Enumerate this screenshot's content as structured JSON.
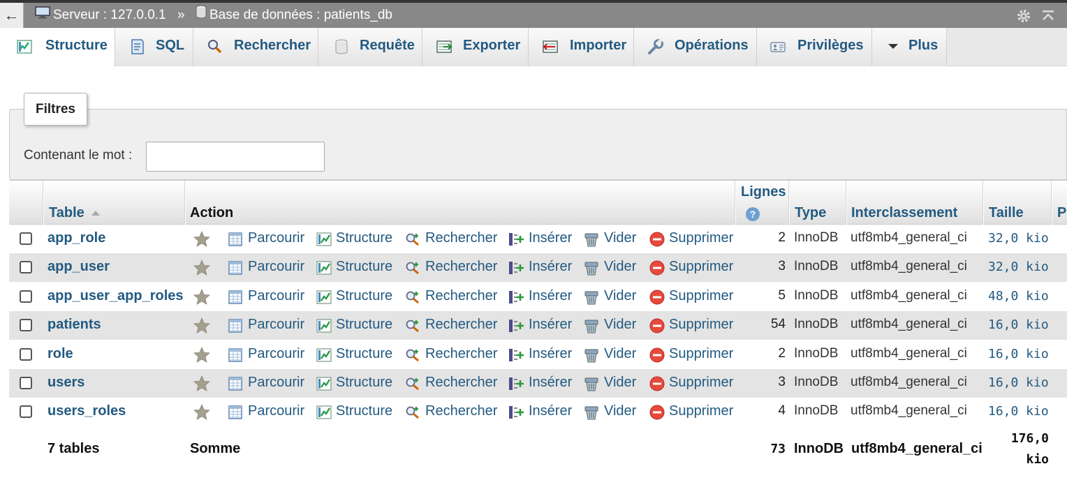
{
  "breadcrumb": {
    "back_symbol": "←",
    "server": "Serveur : 127.0.0.1",
    "separator": "»",
    "database": "Base de données : patients_db"
  },
  "tabs": [
    {
      "label": "Structure",
      "icon": "structure-icon",
      "active": true
    },
    {
      "label": "SQL",
      "icon": "sql-icon"
    },
    {
      "label": "Rechercher",
      "icon": "search-icon"
    },
    {
      "label": "Requête",
      "icon": "query-icon"
    },
    {
      "label": "Exporter",
      "icon": "export-icon"
    },
    {
      "label": "Importer",
      "icon": "import-icon"
    },
    {
      "label": "Opérations",
      "icon": "wrench-icon"
    },
    {
      "label": "Privilèges",
      "icon": "privileges-icon"
    },
    {
      "label": "Plus",
      "icon": "chevron-down-icon"
    }
  ],
  "filters": {
    "legend": "Filtres",
    "label": "Contenant le mot :",
    "value": ""
  },
  "table_headers": {
    "table": "Table",
    "action": "Action",
    "rows": "Lignes",
    "help_symbol": "?",
    "type": "Type",
    "collation": "Interclassement",
    "size": "Taille",
    "overhead": "Pe"
  },
  "actions": {
    "browse": "Parcourir",
    "structure": "Structure",
    "search": "Rechercher",
    "insert": "Insérer",
    "empty": "Vider",
    "drop": "Supprimer"
  },
  "rows": [
    {
      "name": "app_role",
      "rows": "2",
      "type": "InnoDB",
      "collation": "utf8mb4_general_ci",
      "size": "32,0 kio"
    },
    {
      "name": "app_user",
      "rows": "3",
      "type": "InnoDB",
      "collation": "utf8mb4_general_ci",
      "size": "32,0 kio"
    },
    {
      "name": "app_user_app_roles",
      "rows": "5",
      "type": "InnoDB",
      "collation": "utf8mb4_general_ci",
      "size": "48,0 kio"
    },
    {
      "name": "patients",
      "rows": "54",
      "type": "InnoDB",
      "collation": "utf8mb4_general_ci",
      "size": "16,0 kio"
    },
    {
      "name": "role",
      "rows": "2",
      "type": "InnoDB",
      "collation": "utf8mb4_general_ci",
      "size": "16,0 kio"
    },
    {
      "name": "users",
      "rows": "3",
      "type": "InnoDB",
      "collation": "utf8mb4_general_ci",
      "size": "16,0 kio"
    },
    {
      "name": "users_roles",
      "rows": "4",
      "type": "InnoDB",
      "collation": "utf8mb4_general_ci",
      "size": "16,0 kio"
    }
  ],
  "footer": {
    "tables_count": "7 tables",
    "sum_label": "Somme",
    "rows_total": "73",
    "type": "InnoDB",
    "collation": "utf8mb4_general_ci",
    "size_value": "176,0",
    "size_unit": "kio"
  },
  "colors": {
    "link": "#235a81",
    "topbar": "#888888",
    "row_alt": "#e4e4e4"
  }
}
